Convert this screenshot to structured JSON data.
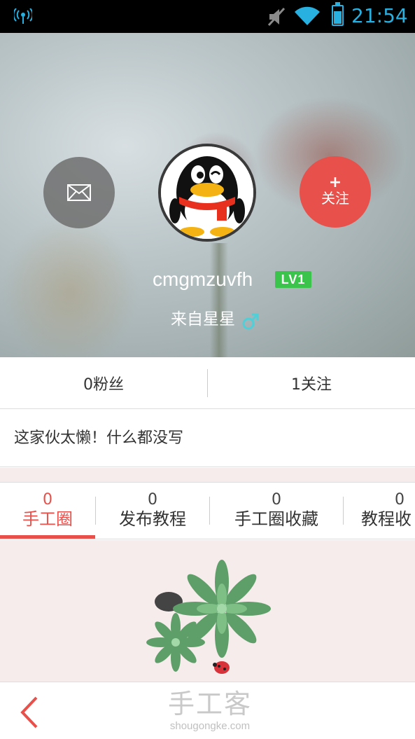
{
  "status_bar": {
    "time": "21:54",
    "icons": [
      "signal-icon",
      "mute-icon",
      "wifi-icon",
      "battery-icon"
    ],
    "accent": "#27b0e0"
  },
  "profile": {
    "follow_plus": "+",
    "follow_label": "关注",
    "username": "cmgmzuvfh",
    "level": "LV1",
    "location": "来自星星",
    "gender_icon": "male-icon",
    "message_icon": "mail-icon"
  },
  "stats": {
    "fans": "0粉丝",
    "following": "1关注"
  },
  "bio": "这家伙太懒！什么都没写",
  "tabs": [
    {
      "count": "0",
      "name": "手工圈",
      "active": true
    },
    {
      "count": "0",
      "name": "发布教程",
      "active": false
    },
    {
      "count": "0",
      "name": "手工圈收藏",
      "active": false
    },
    {
      "count": "0",
      "name": "教程收",
      "active": false
    }
  ],
  "footer": {
    "watermark_cn": "手工客",
    "watermark_en": "shougongke.com"
  },
  "colors": {
    "accent_red": "#e8514b",
    "level_green": "#3bc44b",
    "empty_bg": "#f6ecec"
  }
}
